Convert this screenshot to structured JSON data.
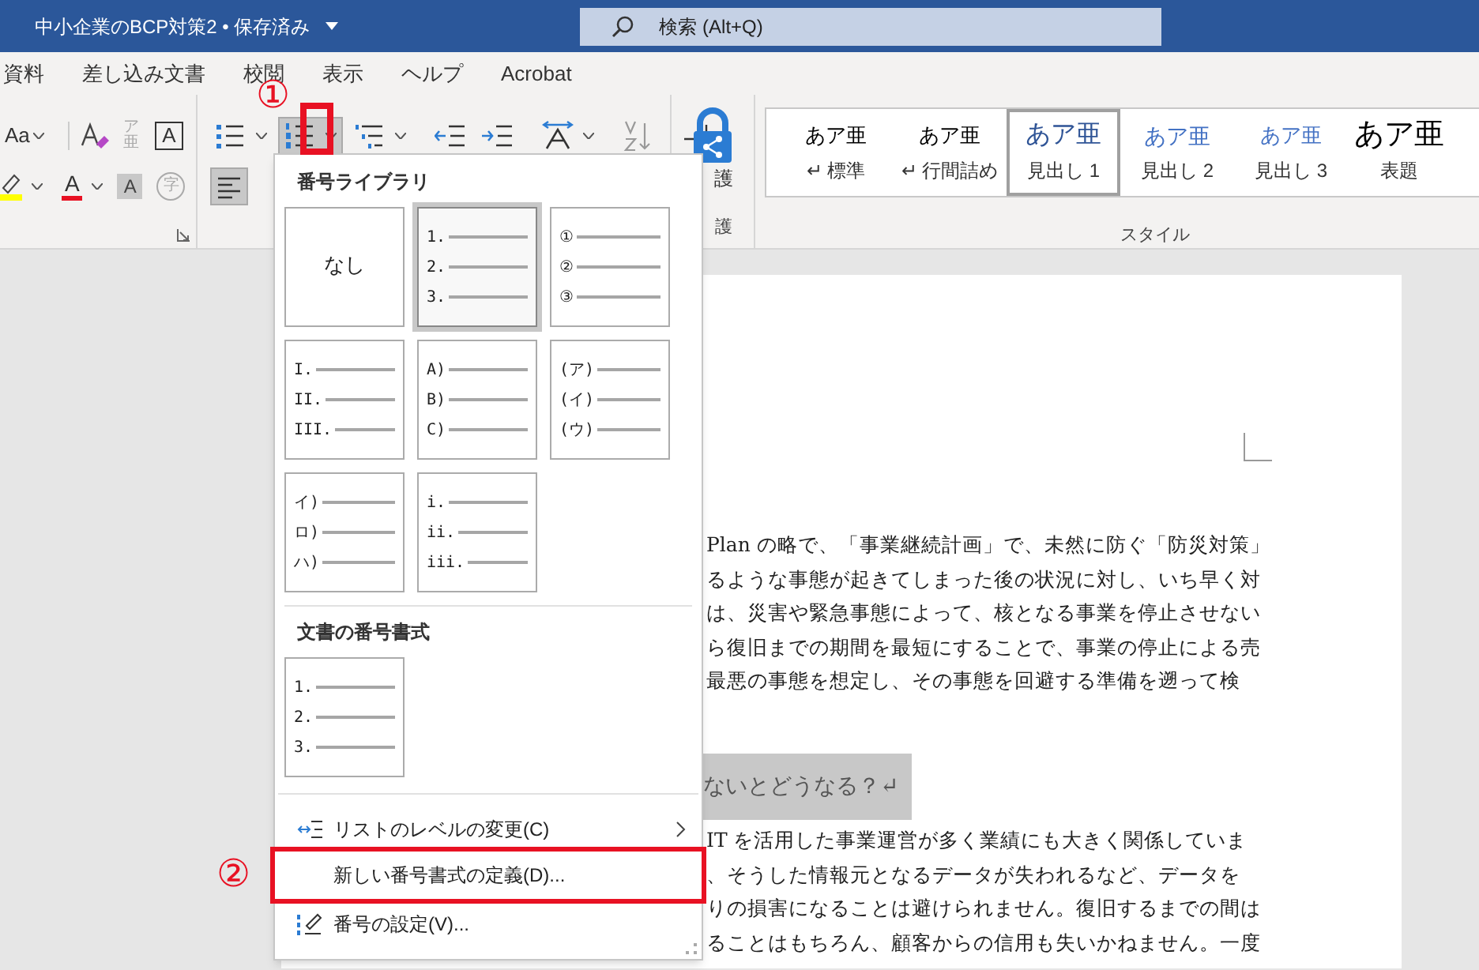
{
  "title_bar": {
    "title": "中小企業のBCP対策2 • 保存済み",
    "search": {
      "placeholder": "検索 (Alt+Q)"
    }
  },
  "tabs": [
    {
      "label": "資料",
      "selected": false
    },
    {
      "label": "差し込み文書",
      "selected": false
    },
    {
      "label": "校閲",
      "selected": false
    },
    {
      "label": "表示",
      "selected": false
    },
    {
      "label": "ヘルプ",
      "selected": false
    },
    {
      "label": "Acrobat",
      "selected": false
    }
  ],
  "ribbon": {
    "font_row_1": [
      {
        "kind": "change_case",
        "glyph": "Aa"
      },
      {
        "kind": "clear_format"
      },
      {
        "kind": "phonetic",
        "glyph": "ア亜"
      },
      {
        "kind": "boxed",
        "glyph": "A"
      }
    ],
    "font_row_2": [
      {
        "kind": "highlight"
      },
      {
        "kind": "font_color",
        "glyph": "A"
      },
      {
        "kind": "shading",
        "glyph": "A"
      },
      {
        "kind": "enclose",
        "glyph": "字"
      }
    ],
    "paragraph_row_1": [
      {
        "kind": "bullets",
        "active": false
      },
      {
        "kind": "numbering",
        "active": true
      },
      {
        "kind": "multilevel",
        "active": false
      },
      {
        "kind": "outdent",
        "active": false
      },
      {
        "kind": "indent",
        "active": false
      },
      {
        "kind": "direction",
        "active": false
      },
      {
        "kind": "sort",
        "active": false
      },
      {
        "kind": "marks",
        "active": false
      }
    ],
    "paragraph_row_2": [
      {
        "kind": "align_left",
        "active": true
      }
    ],
    "protect": {
      "label": "護",
      "group_label": "護"
    },
    "styles": [
      {
        "sample": "あア亜",
        "mark": "↵",
        "label": "標準",
        "selected": false
      },
      {
        "sample": "あア亜",
        "mark": "↵",
        "label": "行間詰め",
        "selected": false
      },
      {
        "sample": "あア亜",
        "label": "見出し 1",
        "selected": true
      },
      {
        "sample": "あア亜",
        "label": "見出し 2",
        "selected": false
      },
      {
        "sample": "あア亜",
        "label": "見出し 3",
        "selected": false
      },
      {
        "sample": "あア亜",
        "label": "表題",
        "selected": false
      }
    ],
    "styles_group_label": "スタイル"
  },
  "numbering_menu": {
    "library_heading": "番号ライブラリ",
    "library": [
      {
        "kind": "none",
        "label": "なし",
        "selected": false
      },
      {
        "kind": "list",
        "markers": [
          "1.",
          "2.",
          "3."
        ],
        "selected": true
      },
      {
        "kind": "list",
        "markers": [
          "①",
          "②",
          "③"
        ],
        "selected": false
      },
      {
        "kind": "list",
        "markers": [
          "I.",
          "II.",
          "III."
        ],
        "selected": false
      },
      {
        "kind": "list",
        "markers": [
          "A)",
          "B)",
          "C)"
        ],
        "selected": false
      },
      {
        "kind": "list",
        "markers": [
          "(ア)",
          "(イ)",
          "(ウ)"
        ],
        "selected": false
      },
      {
        "kind": "list",
        "markers": [
          "イ)",
          "ロ)",
          "ハ)"
        ],
        "selected": false
      },
      {
        "kind": "list",
        "markers": [
          "i.",
          "ii.",
          "iii."
        ],
        "selected": false
      }
    ],
    "document_heading": "文書の番号書式",
    "document_formats": [
      {
        "kind": "list",
        "markers": [
          "1.",
          "2.",
          "3."
        ],
        "selected": false
      }
    ],
    "commands": [
      {
        "label": "リストのレベルの変更(C)",
        "submenu": true
      },
      {
        "label": "新しい番号書式の定義(D)...",
        "submenu": false
      },
      {
        "label": "番号の設定(V)...",
        "submenu": false
      }
    ]
  },
  "document": {
    "paragraph_1": [
      "Plan の略で、「事業継続計画」で、未然に防ぐ「防災対策」",
      "るような事態が起きてしまった後の状況に対し、いち早く対",
      "は、災害や緊急事態によって、核となる事業を停止させない",
      "ら復旧までの期間を最短にすることで、事業の停止による売",
      "最悪の事態を想定し、その事態を回避する準備を遡って検"
    ],
    "heading": "ないとどうなる？↵",
    "paragraph_2": [
      "IT を活用した事業運営が多く業績にも大きく関係していま",
      "、そうした情報元となるデータが失われるなど、データを",
      "りの損害になることは避けられません。復旧するまでの間は",
      "ることはもちろん、顧客からの信用も失いかねません。一度"
    ]
  },
  "annotations": [
    {
      "label": "①"
    },
    {
      "label": "②"
    }
  ]
}
